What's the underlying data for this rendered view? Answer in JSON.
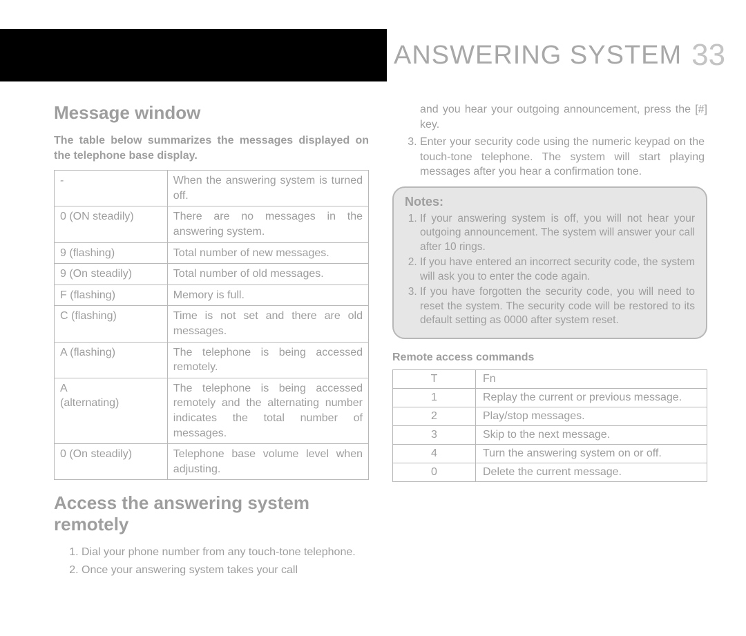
{
  "header": {
    "title": "ANSWERING SYSTEM",
    "page_number": "33"
  },
  "left": {
    "h_message_window": "Message window",
    "lead": "The table below summarizes the messages displayed on the telephone base display.",
    "msg_table": [
      {
        "code": "-",
        "desc": "When the answering system is turned off."
      },
      {
        "code": "0   (ON steadily)",
        "desc": "There are no messages in the answering system."
      },
      {
        "code": "9       (flashing)",
        "desc": "Total number of new messages."
      },
      {
        "code": "9       (On steadily)",
        "desc": "Total number of old messages."
      },
      {
        "code": "F (flashing)",
        "desc": "Memory is full."
      },
      {
        "code": "C    (flashing)",
        "desc": "Time is not set and there are old messages."
      },
      {
        "code": "A   (flashing)",
        "desc": "The telephone is being accessed remotely."
      },
      {
        "code": "A\n(alternating)",
        "desc": "The telephone is being accessed remotely and the alternating number indicates the total number of messages."
      },
      {
        "code": "0        (On steadily)",
        "desc": "Telephone base volume level when adjusting."
      }
    ],
    "h_remote": "Access the answering system remotely",
    "remote_steps_part1": [
      "Dial your phone number from any touch-tone telephone.",
      "Once your answering system takes your call"
    ]
  },
  "right": {
    "continue_text": "and you hear your outgoing announcement, press the [#] key.",
    "remote_steps_part2": [
      "Enter your security code using the numeric keypad on the touch-tone telephone. The system will start playing messages after you hear a confirmation tone."
    ],
    "notes_title": "Notes:",
    "notes": [
      "If your answering system is off, you will not hear your outgoing announcement. The system will answer your call after 10 rings.",
      "If you have entered an incorrect security code, the system will ask you to enter the code again.",
      "If you have forgotten the security code, you will need to reset the system. The security code will be restored to its default setting as 0000 after system reset."
    ],
    "cmds_heading": "Remote access commands",
    "cmds_header": {
      "c1": "T",
      "c2": "Fn"
    },
    "cmds": [
      {
        "key": "1",
        "fn": "Replay the current or previous message."
      },
      {
        "key": "2",
        "fn": "Play/stop messages."
      },
      {
        "key": "3",
        "fn": "Skip to the next message."
      },
      {
        "key": "4",
        "fn": "Turn the answering system on or off."
      },
      {
        "key": "0",
        "fn": "Delete the current message."
      }
    ]
  }
}
